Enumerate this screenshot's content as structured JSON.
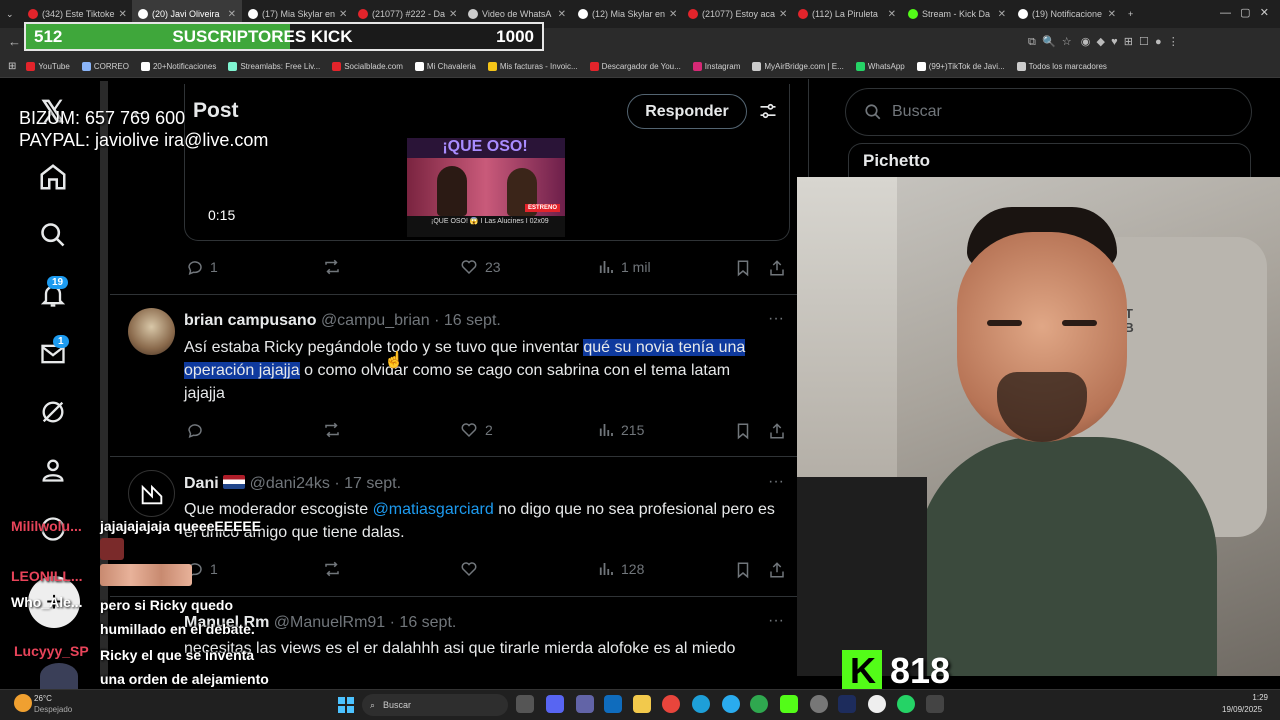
{
  "browser": {
    "tabs": [
      {
        "label": "(342) Este Tiktoke",
        "color": "#e3242b"
      },
      {
        "label": "(20) Javi Oliveira",
        "color": "#ffffff",
        "active": true
      },
      {
        "label": "(17) Mia Skylar en",
        "color": "#ffffff"
      },
      {
        "label": "(21077) #222 - Da",
        "color": "#e3242b"
      },
      {
        "label": "Video de WhatsA",
        "color": "#cccccc"
      },
      {
        "label": "(12) Mia Skylar en",
        "color": "#ffffff"
      },
      {
        "label": "(21077) Estoy aca",
        "color": "#e3242b"
      },
      {
        "label": "(112) La Piruleta",
        "color": "#e3242b"
      },
      {
        "label": "Stream - Kick Da",
        "color": "#53fc18"
      },
      {
        "label": "(19) Notificacione",
        "color": "#ffffff"
      }
    ],
    "bookmarks": [
      {
        "label": "YouTube",
        "color": "#e3242b"
      },
      {
        "label": "CORREO",
        "color": "#8ab4f8"
      },
      {
        "label": "20+Notificaciones",
        "color": "#ffffff"
      },
      {
        "label": "Streamlabs: Free Liv...",
        "color": "#80f5d2"
      },
      {
        "label": "Socialblade.com",
        "color": "#e3242b"
      },
      {
        "label": "Mi Chavaleria",
        "color": "#ffffff"
      },
      {
        "label": "Mis facturas - Invoic...",
        "color": "#f5c518"
      },
      {
        "label": "Descargador de You...",
        "color": "#e3242b"
      },
      {
        "label": "Instagram",
        "color": "#d62976"
      },
      {
        "label": "MyAirBridge.com | E...",
        "color": "#cccccc"
      },
      {
        "label": "WhatsApp",
        "color": "#25d366"
      },
      {
        "label": "(99+)TikTok de Javi...",
        "color": "#ffffff"
      },
      {
        "label": "Todos los marcadores",
        "color": "#cccccc"
      }
    ]
  },
  "overlay": {
    "sub_current": "512",
    "sub_title": "SUSCRIPTORES KICK",
    "sub_goal": "1000",
    "sub_progress": 0.512,
    "bizum": "BIZUM: 657 769 600",
    "paypal": "PAYPAL: javiolive ira@live.com",
    "kick_count": "818"
  },
  "nav": {
    "notifications_badge": "19",
    "messages_badge": "1"
  },
  "header": {
    "title": "Post",
    "reply_button": "Responder"
  },
  "search": {
    "placeholder": "Buscar"
  },
  "sidebar_card": {
    "title": "Pichetto"
  },
  "video_post": {
    "duration": "0:15",
    "thumb_title": "¡QUE OSO!",
    "thumb_caption": "¡QUE OSO! 😱 I Las Alucines I 02x09",
    "thumb_tag": "ESTRENO",
    "replies": "1",
    "likes": "23",
    "views": "1 mil"
  },
  "posts": [
    {
      "name": "brian campusano",
      "handle": "@campu_brian · 16 sept.",
      "text_a": "Así estaba Ricky pegándole todo y se tuvo que inventar",
      "text_hl": "qué su novia tenía una operación jajajja",
      "text_b": "o como olvidar como se cago con sabrina con el tema latam jajajja",
      "replies": "",
      "likes": "2",
      "views": "215"
    },
    {
      "name": "Dani",
      "handle": "@dani24ks · 17 sept.",
      "text_a": "Que moderador escogiste",
      "mention": "@matiasgarciard",
      "text_b": "no digo que no sea profesional pero es el unico amigo que tiene dalas.",
      "replies": "1",
      "likes": "",
      "views": "128"
    },
    {
      "name": "Manuel Rm",
      "handle": "@ManuelRm91 · 16 sept.",
      "text_a": "necesitas las views es el er dalahhh   asi que tirarle mierda alofoke es al",
      "text_b": "miedo"
    }
  ],
  "chat": {
    "names": [
      "Mililwolu...",
      "LEONILL...",
      "Who_Ale...",
      "Lucyyy_SP"
    ],
    "messages": [
      "jajajajajaja queeeEEEEE",
      "pero si Ricky quedo humillado en el debate.",
      "Ricky el que se inventa una orden de alejamiento"
    ]
  },
  "taskbar": {
    "weather_temp": "26°C",
    "weather_desc": "Despejado",
    "search": "Buscar",
    "time": "1:29",
    "date": "19/09/2025"
  }
}
